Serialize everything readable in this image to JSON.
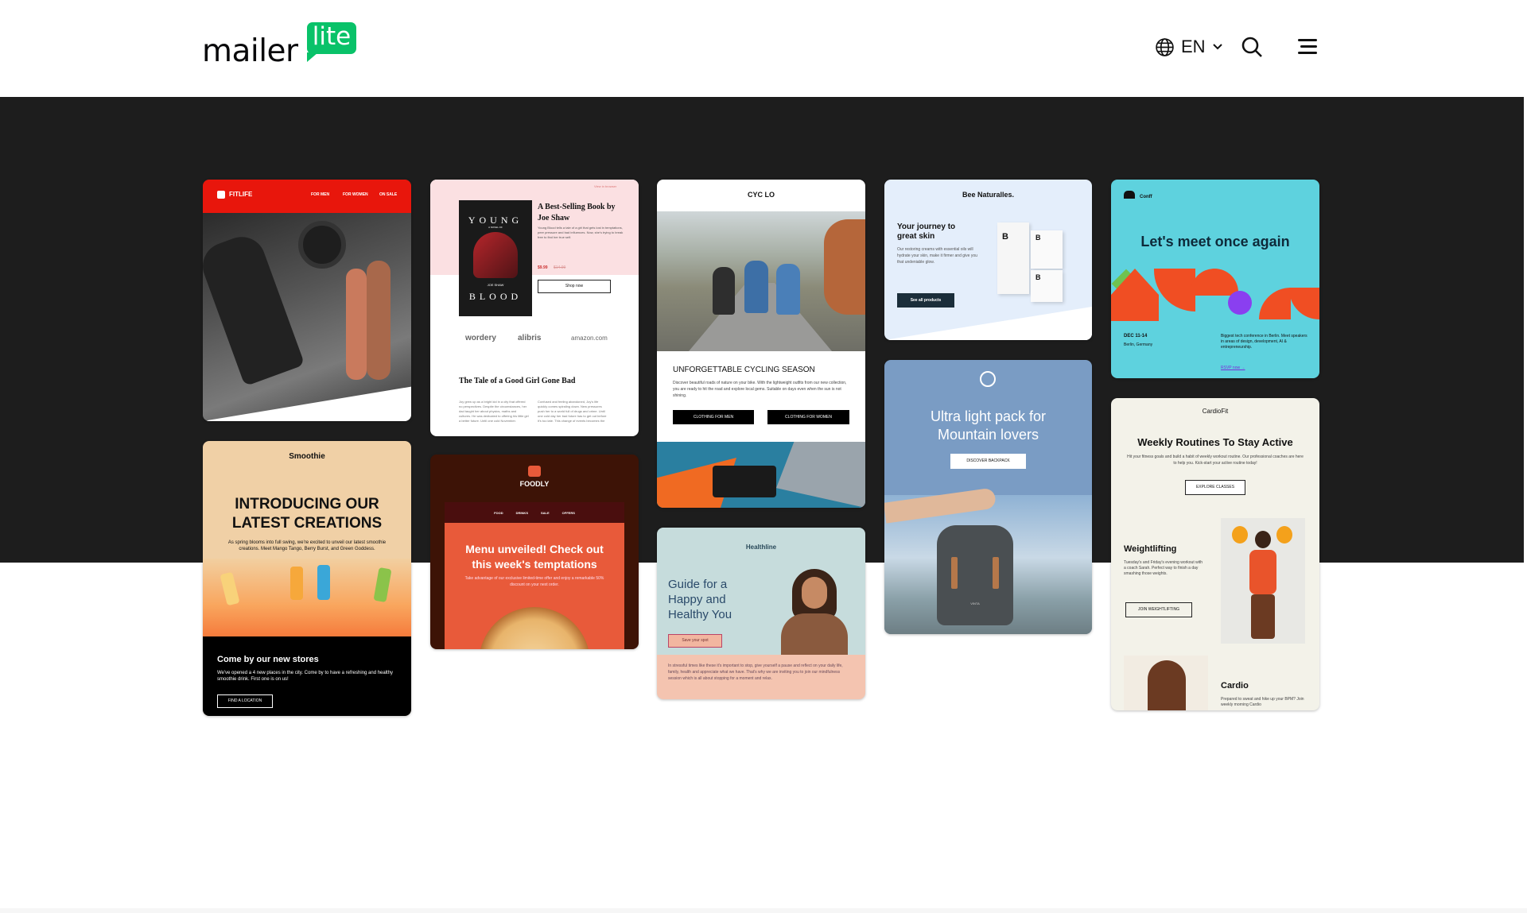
{
  "header": {
    "logo_word": "mailer",
    "logo_bubble": "lite",
    "language": "EN"
  },
  "icons": {
    "globe": "globe-icon",
    "chevron": "chevron-down-icon",
    "search": "search-icon",
    "menu": "hamburger-menu-icon"
  },
  "colors": {
    "brand_green": "#09c269",
    "dark_band": "#1d1d1d"
  },
  "templates": {
    "fitlife": {
      "brand": "FITLIFE",
      "nav": [
        "FOR MEN",
        "FOR WOMEN",
        "ON SALE"
      ]
    },
    "book": {
      "link": "View in browser",
      "cover_top": "YOUNG",
      "cover_mid": "A NOVEL OF",
      "cover_author": "JOE SHAW",
      "cover_bottom": "BLOOD",
      "title": "A Best-Selling Book by Joe Shaw",
      "desc": "Young Blood tells a tale of a girl that gets lost in temptations, peer pressure and bad influences. Now, she's trying to break free to find her true self.",
      "price": "$9.99",
      "old_price": "$14.99",
      "button": "Shop now",
      "stores": [
        "wordery",
        "alibris",
        "amazon.com"
      ],
      "subtitle": "The Tale of a Good Girl Gone Bad",
      "col1": "Joy grew up as a bright kid in a city that offered no perspectives. Despite the circumstances, her dad taught her about physics, maths and cultures. He was dedicated to offering his little girl a better future. Until one cold November.",
      "col2": "Confused and feeling abandoned, Joy's life quickly comes spiraling down. New pressures push her to a world full of drugs and crime. Until one cold day her bad future has to get out before it's too late. This change of events becomes the"
    },
    "cyclo": {
      "brand": "CYC LO",
      "title": "UNFORGETTABLE CYCLING SEASON",
      "desc": "Discover beautiful roads of nature on your bike. With the lightweight outfits from our new collection, you are ready to hit the road and explore local gems. Suitable on days even when the sun is not shining.",
      "btn_men": "CLOTHING FOR MEN",
      "btn_women": "CLOTHING FOR WOMEN"
    },
    "bee": {
      "brand": "Bee Naturalles.",
      "title": "Your journey to great skin",
      "desc": "Our restoring creams with essential oils will hydrate your skin, make it firmer and give you that undeniable glow.",
      "button": "See all products",
      "box_letter": "B"
    },
    "conff": {
      "brand": "Conff",
      "title": "Let's meet once again",
      "date": "DEC 11-14",
      "place": "Berlin, Germany",
      "desc": "Biggest tech conference in Berlin. Meet speakers in areas of design, development, AI & entrepreneurship.",
      "rsvp": "RSVP now →"
    },
    "smoothie": {
      "brand": "Smoothie",
      "title": "INTRODUCING OUR LATEST CREATIONS",
      "desc": "As spring blooms into full swing, we're excited to unveil our latest smoothie creations. Meet Mango Tango, Berry Burst, and Green Goddess.",
      "sub": "Come by our new stores",
      "sub_desc": "We've opened a 4 new places in the city. Come by to have a refreshing and healthy smoothie drink. First one is on us!",
      "button": "FIND A LOCATION"
    },
    "foodly": {
      "brand": "FOODLY",
      "nav": [
        "FOOD",
        "DRINKS",
        "SALE",
        "OFFERS"
      ],
      "title": "Menu unveiled! Check out this week's temptations",
      "desc": "Take advantage of our exclusive limited-time offer and enjoy a remarkable 50% discount on your next order."
    },
    "mountain": {
      "title": "Ultra light pack for Mountain lovers",
      "button": "DISCOVER BACKPACK",
      "bag_label": "VINTA"
    },
    "healthline": {
      "brand": "Healthline",
      "title": "Guide for a Happy and Healthy You",
      "button": "Save your spot",
      "desc": "In stressful times like these it's important to stop, give yourself a pause and reflect on your daily life, family, health and appreciate what we have. That's why we are inviting you to join our mindfulness session which is all about stopping for a moment and relax."
    },
    "cardiofit": {
      "brand": "CardioFit",
      "title": "Weekly Routines To Stay Active",
      "desc": "Hit your fitness goals and build a habit of weekly workout routine. Our professional coaches are here to help you. Kick-start your active routine today!",
      "button": "EXPLORE CLASSES",
      "w_title": "Weightlifting",
      "w_desc": "Tuesday's and Friday's evening workout with a coach Sarah. Perfect way to finish a day smashing those weights.",
      "w_button": "JOIN WEIGHTLIFTING",
      "c_title": "Cardio",
      "c_desc": "Prepared to sweat and hike up your BPM? Join weekly morning Cardio"
    }
  }
}
